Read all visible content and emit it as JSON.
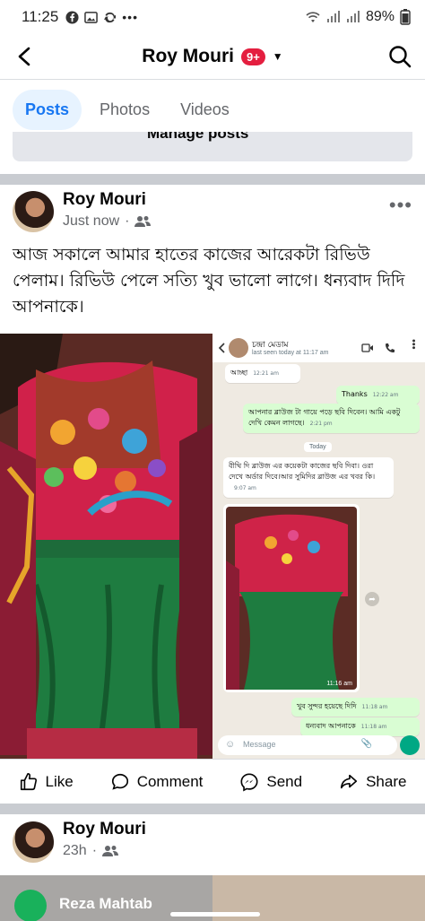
{
  "status_bar": {
    "time": "11:25",
    "battery": "89%"
  },
  "header": {
    "title": "Roy Mouri",
    "badge": "9+"
  },
  "tabs": [
    {
      "label": "Posts",
      "active": true
    },
    {
      "label": "Photos",
      "active": false
    },
    {
      "label": "Videos",
      "active": false
    }
  ],
  "manage_posts": "Manage posts",
  "post1": {
    "author": "Roy Mouri",
    "time": "Just now",
    "text": "আজ সকালে আমার হাতের কাজের আরেকটা রিভিউ পেলাম। রিভিউ পেলে সত্যি খুব ভালো লাগে। ধন্যবাদ দিদি আপনাকে।"
  },
  "chat_screenshot": {
    "contact": "চন্দ্রা মেডাম",
    "last_seen": "last seen today at 11:17 am",
    "messages": [
      {
        "text": "আচ্ছা",
        "time": "12:21 am",
        "dir": "in"
      },
      {
        "text": "Thanks",
        "time": "12:22 am",
        "dir": "out"
      },
      {
        "text": "আপনার ব্লাউজ টা গায়ে পড়ে ছবি দিবেন। আমি একটু দেখি কেমন লাগছে।",
        "time": "2:21 pm",
        "dir": "out"
      },
      {
        "text": "বীথি দি ব্লাউজ এর কয়েকটা কাজের ছবি দিবা। ওরা দেখে অর্ডার দিবে।আর সুমিদির ব্লাউজ এর খবর কি।",
        "time": "9:07 am",
        "dir": "in"
      },
      {
        "text": "খুব সুন্দর হয়েছে দিদি",
        "time": "11:18 am",
        "dir": "out"
      },
      {
        "text": "ধন্যবাদ আপনাকে",
        "time": "11:18 am",
        "dir": "out"
      }
    ],
    "date_label": "Today",
    "image_time": "11:16 am",
    "input_placeholder": "Message"
  },
  "actions": {
    "like": "Like",
    "comment": "Comment",
    "send": "Send",
    "share": "Share"
  },
  "post2": {
    "author": "Roy Mouri",
    "time": "23h",
    "comment_author": "Reza Mahtab"
  },
  "colors": {
    "accent": "#1877f2",
    "badge": "#e41e3f",
    "whatsapp_green": "#00a884"
  }
}
